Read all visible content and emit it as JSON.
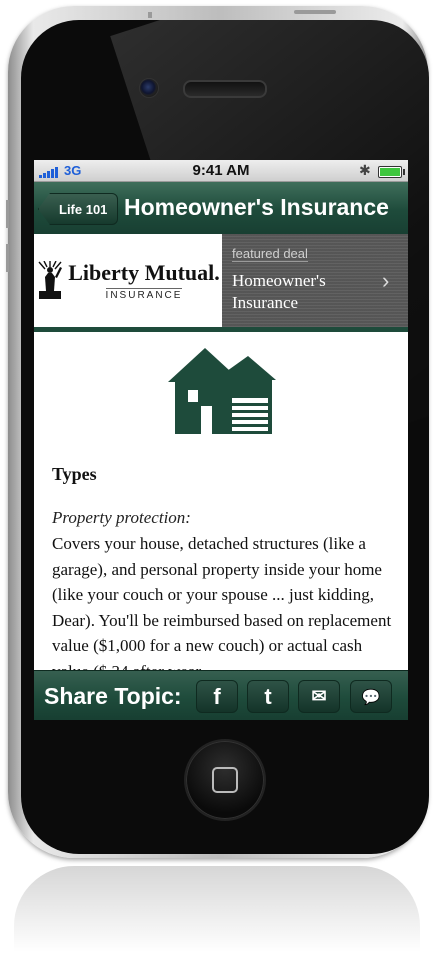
{
  "status_bar": {
    "network": "3G",
    "time": "9:41 AM",
    "bluetooth_icon": "bluetooth-icon",
    "battery_icon": "battery-icon",
    "battery_level": 1.0
  },
  "nav": {
    "back_label": "Life 101",
    "title": "Homeowner's Insurance"
  },
  "banner": {
    "logo_name": "Liberty Mutual.",
    "logo_sub": "INSURANCE",
    "deal_label": "featured deal",
    "deal_title": "Homeowner's Insurance",
    "chevron_icon": "chevron-right-icon"
  },
  "content": {
    "icon": "house-icon",
    "heading": "Types",
    "subheading": "Property protection:",
    "body": "Covers your house, detached structures (like a garage), and personal property inside your home (like your couch or your spouse ... just kidding, Dear). You'll be reimbursed based on replacement value ($1,000 for a new couch) or actual cash value ($ 34 after wear"
  },
  "share": {
    "label": "Share Topic:",
    "buttons": [
      {
        "icon": "facebook-icon",
        "glyph": "f"
      },
      {
        "icon": "twitter-icon",
        "glyph": "t"
      },
      {
        "icon": "mail-icon",
        "glyph": "✉"
      },
      {
        "icon": "message-icon",
        "glyph": "💬"
      }
    ]
  },
  "colors": {
    "brand_green": "#1e4b3b",
    "status_blue": "#1e5fd8"
  }
}
